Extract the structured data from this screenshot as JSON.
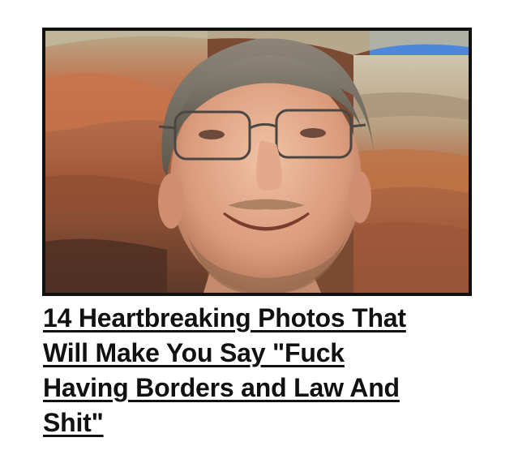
{
  "article": {
    "photo_icon": "selfie-photo",
    "headline_lines": [
      "14 Heartbreaking Photos That",
      "Will Make You Say \"Fuck ",
      "Having Borders and Law And ",
      "Shit\""
    ]
  },
  "colors": {
    "text": "#111111",
    "frame": "#111111",
    "background": "#ffffff"
  }
}
